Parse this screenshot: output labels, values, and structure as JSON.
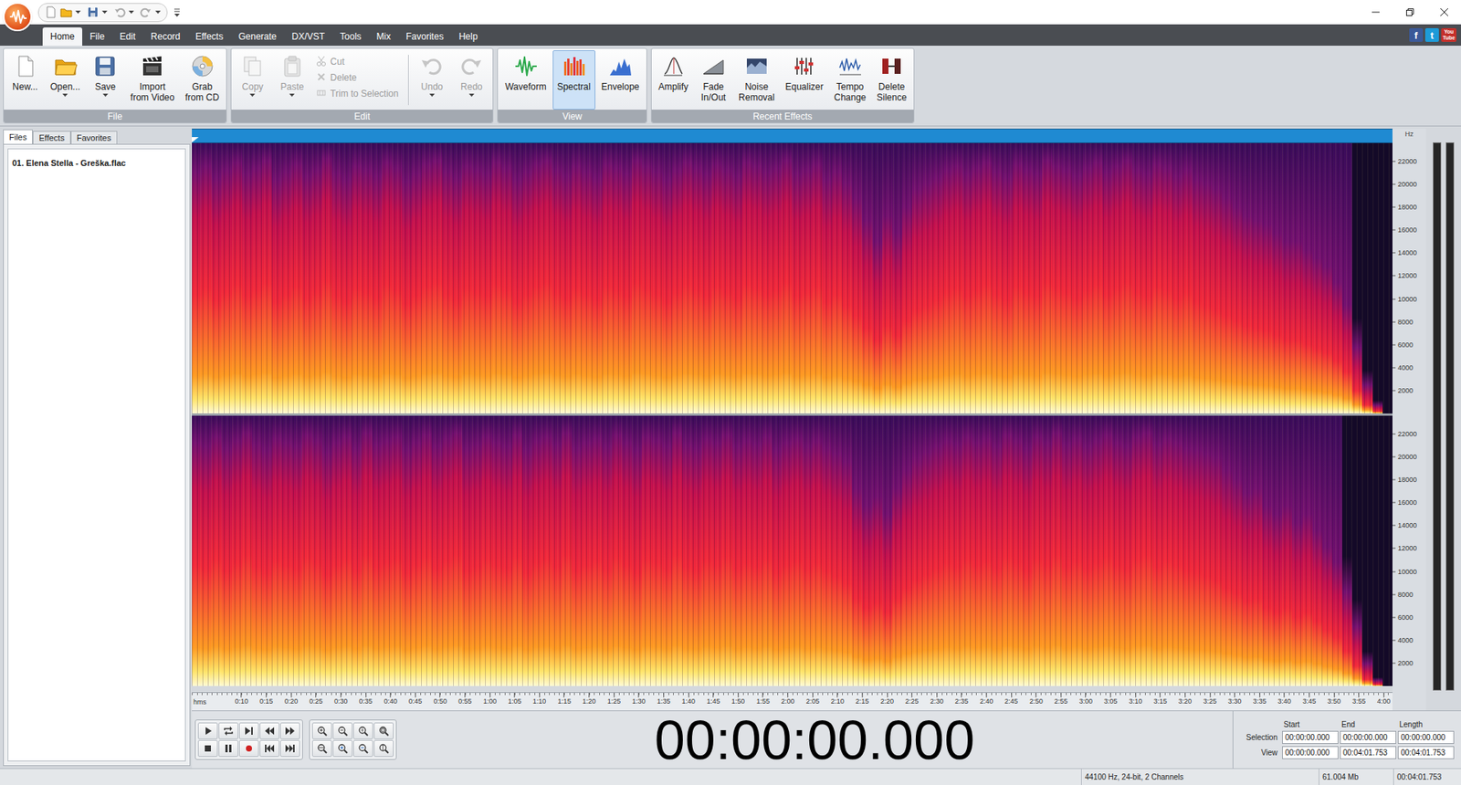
{
  "menu_tabs": [
    {
      "label": "Home",
      "selected": true
    },
    {
      "label": "File",
      "selected": false
    },
    {
      "label": "Edit",
      "selected": false
    },
    {
      "label": "Record",
      "selected": false
    },
    {
      "label": "Effects",
      "selected": false
    },
    {
      "label": "Generate",
      "selected": false
    },
    {
      "label": "DX/VST",
      "selected": false
    },
    {
      "label": "Tools",
      "selected": false
    },
    {
      "label": "Mix",
      "selected": false
    },
    {
      "label": "Favorites",
      "selected": false
    },
    {
      "label": "Help",
      "selected": false
    }
  ],
  "social": [
    {
      "label": "f",
      "color": "#3b5998"
    },
    {
      "label": "t",
      "color": "#1d9bd8"
    },
    {
      "label": "You Tube",
      "color": "#c4302b"
    }
  ],
  "ribbon": {
    "groups": [
      {
        "label": "File",
        "items": [
          {
            "label": "New...",
            "kind": "large",
            "disabled": false
          },
          {
            "label": "Open...",
            "kind": "large",
            "disabled": false,
            "dropdown": true
          },
          {
            "label": "Save",
            "kind": "large",
            "disabled": false,
            "dropdown": true
          },
          {
            "label": "Import\nfrom Video",
            "kind": "large",
            "disabled": false
          },
          {
            "label": "Grab\nfrom CD",
            "kind": "large",
            "disabled": false
          }
        ]
      },
      {
        "label": "Edit",
        "items": [
          {
            "label": "Copy",
            "kind": "large",
            "disabled": true,
            "dropdown": true
          },
          {
            "label": "Paste",
            "kind": "large",
            "disabled": true,
            "dropdown": true
          },
          {
            "label": "Cut",
            "kind": "small",
            "disabled": true
          },
          {
            "label": "Delete",
            "kind": "small",
            "disabled": true
          },
          {
            "label": "Trim to Selection",
            "kind": "small",
            "disabled": true
          },
          {
            "label": "Undo",
            "kind": "large",
            "disabled": true,
            "dropdown": true
          },
          {
            "label": "Redo",
            "kind": "large",
            "disabled": true,
            "dropdown": true
          }
        ]
      },
      {
        "label": "View",
        "items": [
          {
            "label": "Waveform",
            "kind": "large",
            "disabled": false,
            "selected": false
          },
          {
            "label": "Spectral",
            "kind": "large",
            "disabled": false,
            "selected": true
          },
          {
            "label": "Envelope",
            "kind": "large",
            "disabled": false,
            "selected": false
          }
        ]
      },
      {
        "label": "Recent Effects",
        "items": [
          {
            "label": "Amplify",
            "kind": "large",
            "disabled": false
          },
          {
            "label": "Fade\nIn/Out",
            "kind": "large",
            "disabled": false
          },
          {
            "label": "Noise\nRemoval",
            "kind": "large",
            "disabled": false
          },
          {
            "label": "Equalizer",
            "kind": "large",
            "disabled": false
          },
          {
            "label": "Tempo\nChange",
            "kind": "large",
            "disabled": false
          },
          {
            "label": "Delete\nSilence",
            "kind": "large",
            "disabled": false
          }
        ]
      }
    ]
  },
  "left_panel": {
    "tabs": [
      {
        "label": "Files",
        "selected": true
      },
      {
        "label": "Effects",
        "selected": false
      },
      {
        "label": "Favorites",
        "selected": false
      }
    ],
    "files": [
      {
        "name": "01. Elena Stella - Greška.flac",
        "active": true
      }
    ]
  },
  "spectrogram": {
    "unit": "Hz",
    "channels": [
      {
        "freq_ticks": [
          "22000",
          "20000",
          "18000",
          "16000",
          "14000",
          "12000",
          "10000",
          "8000",
          "6000",
          "4000",
          "2000"
        ],
        "energy": [
          0.78,
          0.84,
          0.72,
          0.8,
          0.88,
          0.76,
          0.82,
          0.9,
          0.7,
          0.78,
          0.86,
          0.74,
          0.8,
          0.92,
          0.76,
          0.7,
          0.84,
          0.8,
          0.74,
          0.88,
          0.82,
          0.68,
          0.76,
          0.86,
          0.9,
          0.78,
          0.72,
          0.84,
          0.8,
          0.76,
          0.88,
          0.82,
          0.7,
          0.78,
          0.86,
          0.9,
          0.8,
          0.74,
          0.84,
          0.78,
          0.72,
          0.86,
          0.82,
          0.76,
          0.9,
          0.84,
          0.78,
          0.7,
          0.8,
          0.88,
          0.82,
          0.76,
          0.86,
          0.8,
          0.74,
          0.88,
          0.84,
          0.78,
          0.82,
          0.9,
          0.76,
          0.8,
          0.86,
          0.7,
          0.78,
          0.66,
          0.6,
          0.55,
          0.5,
          0.56,
          0.52,
          0.58,
          0.62,
          0.66,
          0.72,
          0.8,
          0.84,
          0.76,
          0.82,
          0.88,
          0.78,
          0.72,
          0.86,
          0.8,
          0.76,
          0.9,
          0.84,
          0.8,
          0.74,
          0.82,
          0.88,
          0.78,
          0.84,
          0.9,
          0.8,
          0.76,
          0.86,
          0.82,
          0.74,
          0.8,
          0.7,
          0.66,
          0.62,
          0.6,
          0.58,
          0.56,
          0.55,
          0.54,
          0.52,
          0.5,
          0.5,
          0.48,
          0.46,
          0.44,
          0.4,
          0.34,
          0.22,
          0.1,
          0.03,
          0.0
        ]
      },
      {
        "freq_ticks": [
          "22000",
          "20000",
          "18000",
          "16000",
          "14000",
          "12000",
          "10000",
          "8000",
          "6000",
          "4000",
          "2000"
        ],
        "energy": [
          0.8,
          0.76,
          0.86,
          0.74,
          0.82,
          0.9,
          0.78,
          0.72,
          0.84,
          0.8,
          0.76,
          0.88,
          0.82,
          0.7,
          0.8,
          0.86,
          0.74,
          0.9,
          0.78,
          0.82,
          0.86,
          0.72,
          0.8,
          0.88,
          0.76,
          0.84,
          0.9,
          0.74,
          0.78,
          0.86,
          0.8,
          0.76,
          0.88,
          0.72,
          0.82,
          0.86,
          0.78,
          0.9,
          0.74,
          0.8,
          0.84,
          0.76,
          0.88,
          0.8,
          0.72,
          0.86,
          0.82,
          0.76,
          0.9,
          0.78,
          0.74,
          0.84,
          0.8,
          0.88,
          0.76,
          0.82,
          0.78,
          0.86,
          0.72,
          0.8,
          0.84,
          0.76,
          0.82,
          0.74,
          0.68,
          0.62,
          0.56,
          0.52,
          0.54,
          0.5,
          0.56,
          0.6,
          0.64,
          0.7,
          0.76,
          0.82,
          0.78,
          0.86,
          0.8,
          0.84,
          0.76,
          0.88,
          0.82,
          0.74,
          0.86,
          0.8,
          0.9,
          0.78,
          0.84,
          0.76,
          0.82,
          0.88,
          0.8,
          0.76,
          0.86,
          0.9,
          0.78,
          0.84,
          0.8,
          0.74,
          0.72,
          0.68,
          0.64,
          0.6,
          0.58,
          0.55,
          0.56,
          0.52,
          0.5,
          0.52,
          0.48,
          0.5,
          0.46,
          0.42,
          0.38,
          0.3,
          0.2,
          0.08,
          0.02,
          0.0
        ]
      }
    ]
  },
  "meters": [
    {
      "level": 0
    },
    {
      "level": 0
    }
  ],
  "ruler": {
    "unit": "hms",
    "labels": [
      "0:10",
      "0:15",
      "0:20",
      "0:25",
      "0:30",
      "0:35",
      "0:40",
      "0:45",
      "0:50",
      "0:55",
      "1:00",
      "1:05",
      "1:10",
      "1:15",
      "1:20",
      "1:25",
      "1:30",
      "1:35",
      "1:40",
      "1:45",
      "1:50",
      "1:55",
      "2:00",
      "2:05",
      "2:10",
      "2:15",
      "2:20",
      "2:25",
      "2:30",
      "2:35",
      "2:40",
      "2:45",
      "2:50",
      "2:55",
      "3:00",
      "3:05",
      "3:10",
      "3:15",
      "3:20",
      "3:25",
      "3:30",
      "3:35",
      "3:40",
      "3:45",
      "3:50",
      "3:55",
      "4:00"
    ]
  },
  "time_display": "00:00:00.000",
  "selection": {
    "headers": [
      "Start",
      "End",
      "Length"
    ],
    "rows": [
      {
        "label": "Selection",
        "values": [
          "00:00:00.000",
          "00:00:00.000",
          "00:00:00.000"
        ]
      },
      {
        "label": "View",
        "values": [
          "00:00:00.000",
          "00:04:01.753",
          "00:04:01.753"
        ]
      }
    ]
  },
  "status_bar": [
    "44100 Hz, 24-bit, 2 Channels",
    "61.004 Mb",
    "00:04:01.753"
  ]
}
